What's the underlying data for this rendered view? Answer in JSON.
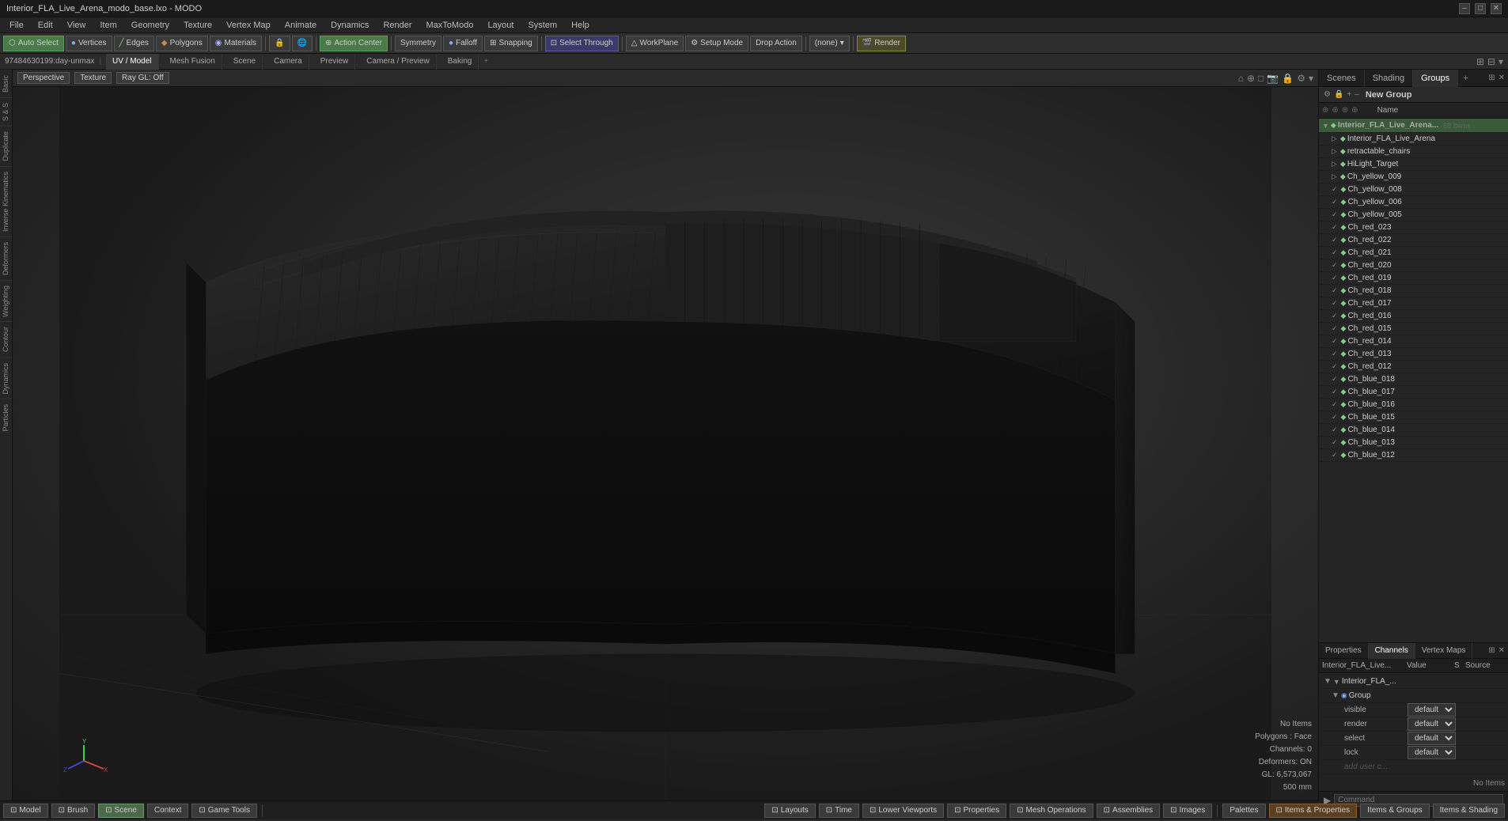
{
  "titleBar": {
    "title": "Interior_FLA_Live_Arena_modo_base.lxo - MODO",
    "controls": [
      "–",
      "□",
      "✕"
    ]
  },
  "menuBar": {
    "items": [
      "File",
      "Edit",
      "View",
      "Item",
      "Geometry",
      "Texture",
      "Vertex Map",
      "Animate",
      "Dynamics",
      "Render",
      "MaxToModo",
      "Layout",
      "System",
      "Help"
    ]
  },
  "toolbar": {
    "autoSelect": "Auto Select",
    "vertices": "Vertices",
    "edges": "Edges",
    "polygons": "Polygons",
    "materials": "Materials",
    "actionCenter": "Action Center",
    "symmetry": "Symmetry",
    "falloff": "Falloff",
    "snapping": "Snapping",
    "selectThrough": "Select Through",
    "workPlane": "WorkPlane",
    "setupMode": "Setup Mode",
    "dropAction": "Drop Action",
    "none": "(none)",
    "render": "Render"
  },
  "sceneStrip": {
    "id": "97484630199:day-unmax",
    "tabs": [
      "UV / Model",
      "Mesh Fusion",
      "Scene",
      "Camera",
      "Preview",
      "Camera / Preview",
      "Baking"
    ],
    "plus": "+"
  },
  "viewport": {
    "perspective": "Perspective",
    "texture": "Texture",
    "rayGL": "Ray GL: Off"
  },
  "rightPanelTabs": {
    "scenes": "Scenes",
    "shading": "Shading",
    "groups": "Groups",
    "plus": "+"
  },
  "newGroup": {
    "label": "New Group"
  },
  "sceneList": {
    "nameCol": "Name",
    "groupItem": {
      "name": "Interior_FLA_Live_Arena...",
      "count": "68 Items"
    },
    "items": [
      "Interior_FLA_Live_Arena",
      "retractable_chairs",
      "HiLight_Target",
      "Ch_yellow_009",
      "Ch_yellow_008",
      "Ch_yellow_006",
      "Ch_yellow_005",
      "Ch_red_023",
      "Ch_red_022",
      "Ch_red_021",
      "Ch_red_020",
      "Ch_red_019",
      "Ch_red_018",
      "Ch_red_017",
      "Ch_red_016",
      "Ch_red_015",
      "Ch_red_014",
      "Ch_red_013",
      "Ch_red_012",
      "Ch_blue_018",
      "Ch_blue_017",
      "Ch_blue_016",
      "Ch_blue_015",
      "Ch_blue_014",
      "Ch_blue_013",
      "Ch_blue_012"
    ]
  },
  "propertiesPanel": {
    "tabs": [
      "Properties",
      "Channels",
      "Vertex Maps"
    ],
    "activeTab": "Channels",
    "headerLeft": "Interior_FLA_Live...",
    "headerMid": "Value",
    "headerRight": "S",
    "headerFar": "Source",
    "groupLabel": "Interior_FLA_...",
    "subGroup": "Group",
    "rows": [
      {
        "key": "visible",
        "value": "default"
      },
      {
        "key": "render",
        "value": "default"
      },
      {
        "key": "select",
        "value": "default"
      },
      {
        "key": "lock",
        "value": "default"
      }
    ],
    "addUser": "add user c..."
  },
  "infoOverlay": {
    "noItems": "No Items",
    "polygons": "Polygons : Face",
    "channels": "Channels: 0",
    "deformers": "Deformers: ON",
    "gl": "GL: 6,573,067",
    "size": "500 mm"
  },
  "commandBar": {
    "arrow": "▶",
    "placeholder": "Command"
  },
  "bottomToolbar": {
    "model": "Model",
    "brush": "Brush",
    "scene": "Scene",
    "context": "Context",
    "gameTools": "Game Tools",
    "layouts": "Layouts",
    "time": "Time",
    "lowerViewports": "Lower Viewports",
    "properties": "Properties",
    "meshOperations": "Mesh Operations",
    "assemblies": "Assemblies",
    "images": "Images",
    "palettes": "Palettes",
    "itemsProperties": "Items & Properties",
    "itemsGroups": "Items & Groups",
    "itemsShading": "Items & Shading"
  },
  "colors": {
    "accent": "#4a7a4a",
    "orange": "#8a6030",
    "blue": "#2a6a9a"
  }
}
